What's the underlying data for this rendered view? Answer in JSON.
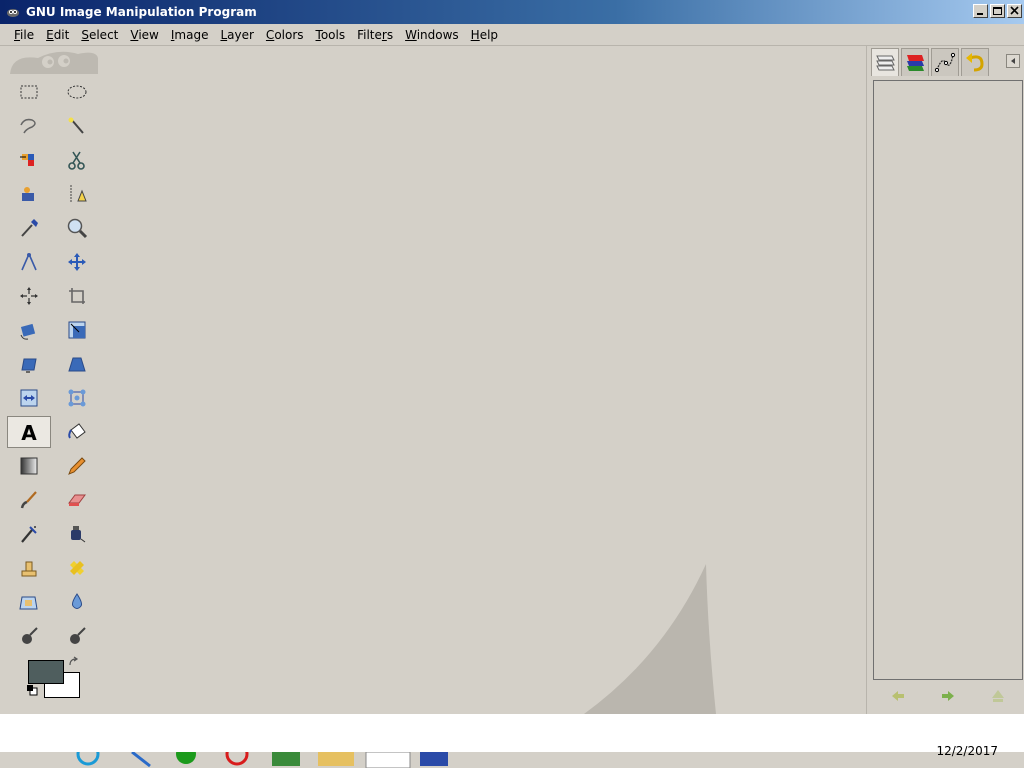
{
  "window": {
    "title": "GNU Image Manipulation Program"
  },
  "menu": [
    {
      "label": "File",
      "ul": "F",
      "rest": "ile"
    },
    {
      "label": "Edit",
      "ul": "E",
      "rest": "dit"
    },
    {
      "label": "Select",
      "ul": "S",
      "rest": "elect"
    },
    {
      "label": "View",
      "ul": "V",
      "rest": "iew"
    },
    {
      "label": "Image",
      "ul": "I",
      "rest": "mage"
    },
    {
      "label": "Layer",
      "ul": "L",
      "rest": "ayer"
    },
    {
      "label": "Colors",
      "ul": "C",
      "rest": "olors"
    },
    {
      "label": "Tools",
      "ul": "T",
      "rest": "ools"
    },
    {
      "label": "Filters",
      "ul": "r",
      "pre": "Filte",
      "rest": "s"
    },
    {
      "label": "Windows",
      "ul": "W",
      "rest": "indows"
    },
    {
      "label": "Help",
      "ul": "H",
      "rest": "elp"
    }
  ],
  "tools": [
    {
      "name": "rect-select-tool-icon"
    },
    {
      "name": "ellipse-select-tool-icon"
    },
    {
      "name": "free-select-tool-icon"
    },
    {
      "name": "fuzzy-select-tool-icon"
    },
    {
      "name": "select-by-color-tool-icon"
    },
    {
      "name": "scissors-select-tool-icon"
    },
    {
      "name": "foreground-select-tool-icon"
    },
    {
      "name": "paths-tool-icon"
    },
    {
      "name": "color-picker-tool-icon"
    },
    {
      "name": "zoom-tool-icon"
    },
    {
      "name": "measure-tool-icon"
    },
    {
      "name": "move-tool-icon"
    },
    {
      "name": "align-tool-icon"
    },
    {
      "name": "crop-tool-icon"
    },
    {
      "name": "rotate-tool-icon"
    },
    {
      "name": "scale-tool-icon"
    },
    {
      "name": "shear-tool-icon"
    },
    {
      "name": "perspective-tool-icon"
    },
    {
      "name": "flip-tool-icon"
    },
    {
      "name": "cage-transform-tool-icon"
    },
    {
      "name": "text-tool-icon"
    },
    {
      "name": "bucket-fill-tool-icon"
    },
    {
      "name": "blend-tool-icon"
    },
    {
      "name": "pencil-tool-icon"
    },
    {
      "name": "paintbrush-tool-icon"
    },
    {
      "name": "eraser-tool-icon"
    },
    {
      "name": "airbrush-tool-icon"
    },
    {
      "name": "ink-tool-icon"
    },
    {
      "name": "clone-tool-icon"
    },
    {
      "name": "heal-tool-icon"
    },
    {
      "name": "perspective-clone-tool-icon"
    },
    {
      "name": "blur-sharpen-tool-icon"
    },
    {
      "name": "smudge-tool-icon"
    },
    {
      "name": "dodge-burn-tool-icon"
    }
  ],
  "colors": {
    "foreground": "#4f5e5e",
    "background": "#ffffff"
  },
  "dock_tabs": [
    "layers-icon",
    "channels-icon",
    "paths-icon",
    "undo-history-icon"
  ],
  "clock": "12/2/2017"
}
